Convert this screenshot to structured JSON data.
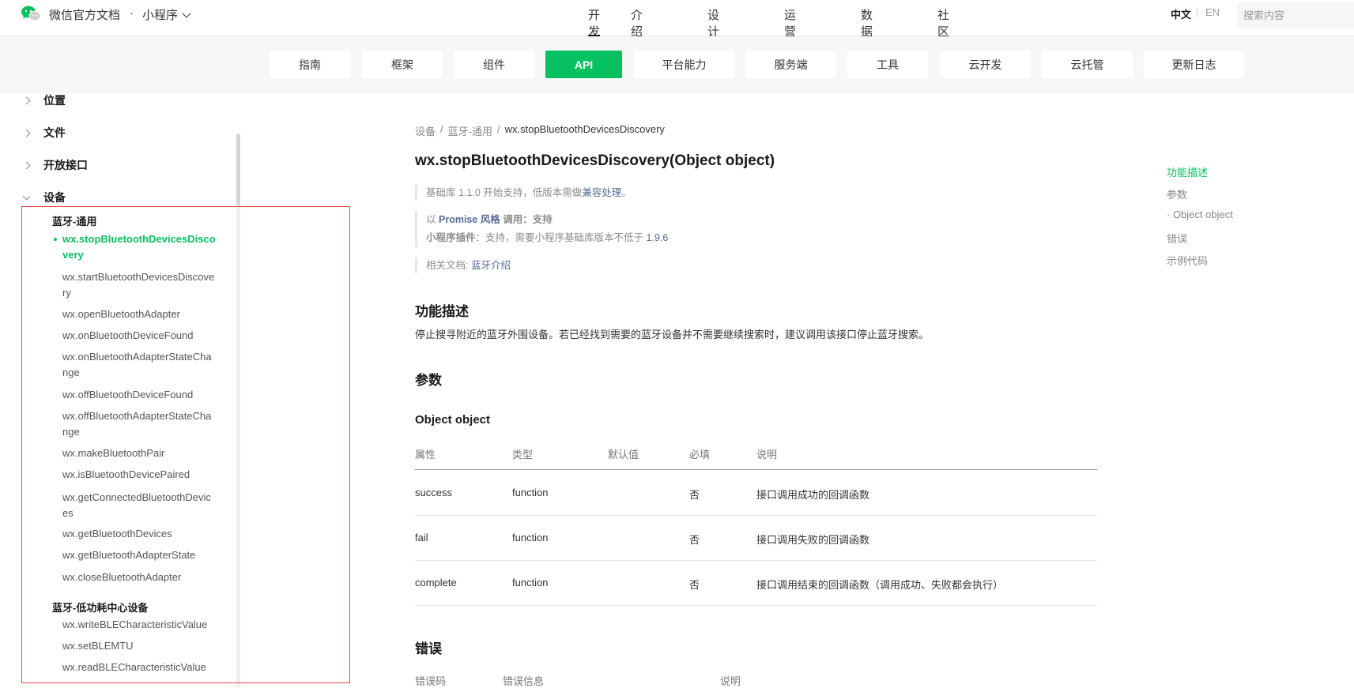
{
  "header": {
    "site_title": "微信官方文档",
    "title_sep": "·",
    "product": "小程序",
    "nav": [
      {
        "label": "开发",
        "active": true
      },
      {
        "label": "介绍",
        "active": false
      },
      {
        "label": "设计",
        "active": false
      },
      {
        "label": "运营",
        "active": false
      },
      {
        "label": "数据",
        "active": false
      },
      {
        "label": "社区",
        "active": false
      }
    ],
    "lang_zh": "中文",
    "lang_en": "EN",
    "search_placeholder": "搜索内容",
    "brand_color": "#07c160"
  },
  "subnav": {
    "tabs": [
      {
        "label": "指南",
        "active": false
      },
      {
        "label": "框架",
        "active": false
      },
      {
        "label": "组件",
        "active": false
      },
      {
        "label": "API",
        "active": true
      },
      {
        "label": "平台能力",
        "active": false
      },
      {
        "label": "服务端",
        "active": false
      },
      {
        "label": "工具",
        "active": false
      },
      {
        "label": "云开发",
        "active": false
      },
      {
        "label": "云托管",
        "active": false
      },
      {
        "label": "更新日志",
        "active": false
      }
    ]
  },
  "sidebar": {
    "categories": [
      {
        "label": "位置",
        "expanded": false
      },
      {
        "label": "文件",
        "expanded": false
      },
      {
        "label": "开放接口",
        "expanded": false
      },
      {
        "label": "设备",
        "expanded": true
      }
    ],
    "groups": [
      {
        "title": "蓝牙-通用",
        "items": [
          {
            "label": "wx.stopBluetoothDevicesDiscovery",
            "active": true
          },
          {
            "label": "wx.startBluetoothDevicesDiscovery",
            "active": false
          },
          {
            "label": "wx.openBluetoothAdapter",
            "active": false
          },
          {
            "label": "wx.onBluetoothDeviceFound",
            "active": false
          },
          {
            "label": "wx.onBluetoothAdapterStateChange",
            "active": false
          },
          {
            "label": "wx.offBluetoothDeviceFound",
            "active": false
          },
          {
            "label": "wx.offBluetoothAdapterStateChange",
            "active": false
          },
          {
            "label": "wx.makeBluetoothPair",
            "active": false
          },
          {
            "label": "wx.isBluetoothDevicePaired",
            "active": false
          },
          {
            "label": "wx.getConnectedBluetoothDevices",
            "active": false
          },
          {
            "label": "wx.getBluetoothDevices",
            "active": false
          },
          {
            "label": "wx.getBluetoothAdapterState",
            "active": false
          },
          {
            "label": "wx.closeBluetoothAdapter",
            "active": false
          }
        ]
      },
      {
        "title": "蓝牙-低功耗中心设备",
        "items": [
          {
            "label": "wx.writeBLECharacteristicValue",
            "active": false
          },
          {
            "label": "wx.setBLEMTU",
            "active": false
          },
          {
            "label": "wx.readBLECharacteristicValue",
            "active": false
          }
        ]
      }
    ]
  },
  "breadcrumb": [
    "设备",
    "蓝牙-通用",
    "wx.stopBluetoothDevicesDiscovery"
  ],
  "breadcrumb_sep": "/",
  "doc": {
    "title": "wx.stopBluetoothDevicesDiscovery(Object object)",
    "support_prefix": "基础库 1.1.0 开始支持，低版本需做",
    "support_link": "兼容处理",
    "support_suffix": "。",
    "promise_prefix": "以",
    "promise_link": "Promise 风格",
    "promise_suffix": "调用：支持",
    "plugin_label": "小程序插件",
    "plugin_text": "：支持，需要小程序基础库版本不低于",
    "plugin_version": "1.9.6",
    "related_label": "相关文档:",
    "related_link": "蓝牙介绍",
    "section_desc": "功能描述",
    "desc_text": "停止搜寻附近的蓝牙外围设备。若已经找到需要的蓝牙设备并不需要继续搜索时，建议调用该接口停止蓝牙搜索。",
    "section_params": "参数",
    "subsection_object": "Object object",
    "param_headers": [
      "属性",
      "类型",
      "默认值",
      "必填",
      "说明"
    ],
    "params": [
      {
        "name": "success",
        "type": "function",
        "default": "",
        "required": "否",
        "desc": "接口调用成功的回调函数"
      },
      {
        "name": "fail",
        "type": "function",
        "default": "",
        "required": "否",
        "desc": "接口调用失败的回调函数"
      },
      {
        "name": "complete",
        "type": "function",
        "default": "",
        "required": "否",
        "desc": "接口调用结束的回调函数（调用成功、失败都会执行）"
      }
    ],
    "section_errors": "错误",
    "error_headers": [
      "错误码",
      "错误信息",
      "说明"
    ]
  },
  "toc": [
    {
      "label": "功能描述",
      "active": true
    },
    {
      "label": "参数",
      "active": false
    },
    {
      "label": "· Object object",
      "active": false
    },
    {
      "label": "错误",
      "active": false
    },
    {
      "label": "示例代码",
      "active": false
    }
  ]
}
